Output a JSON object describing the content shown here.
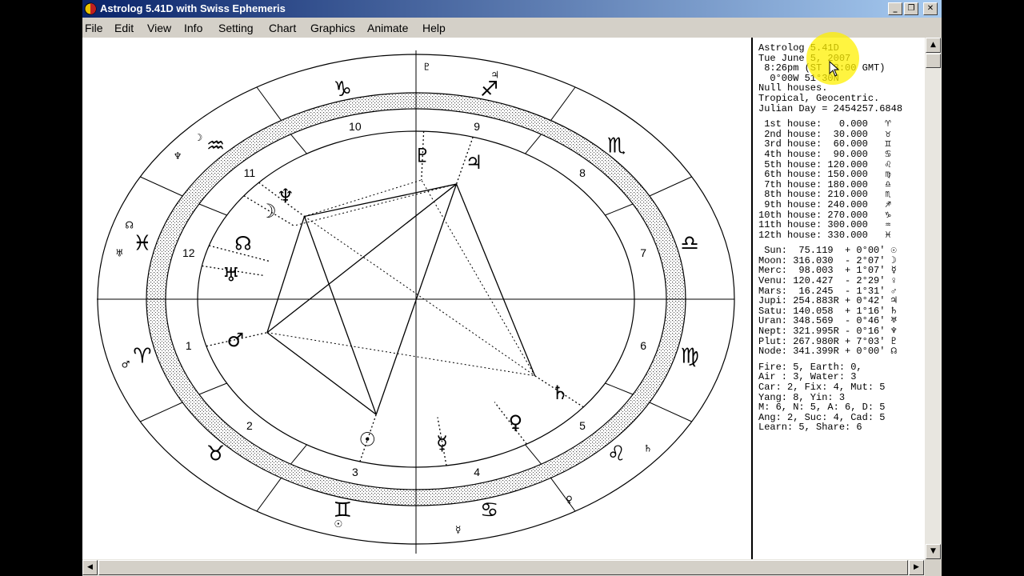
{
  "window": {
    "title": "Astrolog 5.41D with Swiss Ephemeris",
    "controls": {
      "minimize": "_",
      "maximize": "❐",
      "close": "✕"
    }
  },
  "menu": [
    "File",
    "Edit",
    "View",
    "Info",
    "Setting",
    "Chart",
    "Graphics",
    "Animate",
    "Help"
  ],
  "chart": {
    "house_numbers": [
      "1",
      "2",
      "3",
      "4",
      "5",
      "6",
      "7",
      "8",
      "9",
      "10",
      "11",
      "12"
    ],
    "sign_glyphs": [
      "♈",
      "♉",
      "♊",
      "♋",
      "♌",
      "♍",
      "♎",
      "♏",
      "♐",
      "♑",
      "♒",
      "♓"
    ],
    "planets": [
      {
        "name": "Sun",
        "glyph": "☉"
      },
      {
        "name": "Moon",
        "glyph": "☽"
      },
      {
        "name": "Mercury",
        "glyph": "☿"
      },
      {
        "name": "Venus",
        "glyph": "♀"
      },
      {
        "name": "Mars",
        "glyph": "♂"
      },
      {
        "name": "Jupiter",
        "glyph": "♃"
      },
      {
        "name": "Saturn",
        "glyph": "♄"
      },
      {
        "name": "Uranus",
        "glyph": "♅"
      },
      {
        "name": "Neptune",
        "glyph": "♆"
      },
      {
        "name": "Pluto",
        "glyph": "♇"
      },
      {
        "name": "Node",
        "glyph": "☊"
      }
    ]
  },
  "info": {
    "header": [
      "Astrolog 5.41D",
      "Tue June 5, 2007",
      " 8:26pm (ST -8:00 GMT)",
      "  0°00W 51°30N",
      "Null houses.",
      "Tropical, Geocentric.",
      "Julian Day = 2454257.6848"
    ],
    "houses": [
      " 1st house:   0.000   ♈",
      " 2nd house:  30.000   ♉",
      " 3rd house:  60.000   ♊",
      " 4th house:  90.000   ♋",
      " 5th house: 120.000   ♌",
      " 6th house: 150.000   ♍",
      " 7th house: 180.000   ♎",
      " 8th house: 210.000   ♏",
      " 9th house: 240.000   ♐",
      "10th house: 270.000   ♑",
      "11th house: 300.000   ♒",
      "12th house: 330.000   ♓"
    ],
    "planets": [
      " Sun:  75.119  + 0°00' ☉",
      "Moon: 316.030  - 2°07' ☽",
      "Merc:  98.003  + 1°07' ☿",
      "Venu: 120.427  - 2°29' ♀",
      "Mars:  16.245  - 1°31' ♂",
      "Jupi: 254.883R + 0°42' ♃",
      "Satu: 140.058  + 1°16' ♄",
      "Uran: 348.569  - 0°46' ♅",
      "Nept: 321.995R - 0°16' ♆",
      "Plut: 267.980R + 7°03' ♇",
      "Node: 341.399R + 0°00' ☊"
    ],
    "summary": [
      "Fire: 5, Earth: 0,",
      "Air : 3, Water: 3",
      "Car: 2, Fix: 4, Mut: 5",
      "Yang: 8, Yin: 3",
      "M: 6, N: 5, A: 6, D: 5",
      "Ang: 2, Suc: 4, Cad: 5",
      "Learn: 5, Share: 6"
    ]
  }
}
